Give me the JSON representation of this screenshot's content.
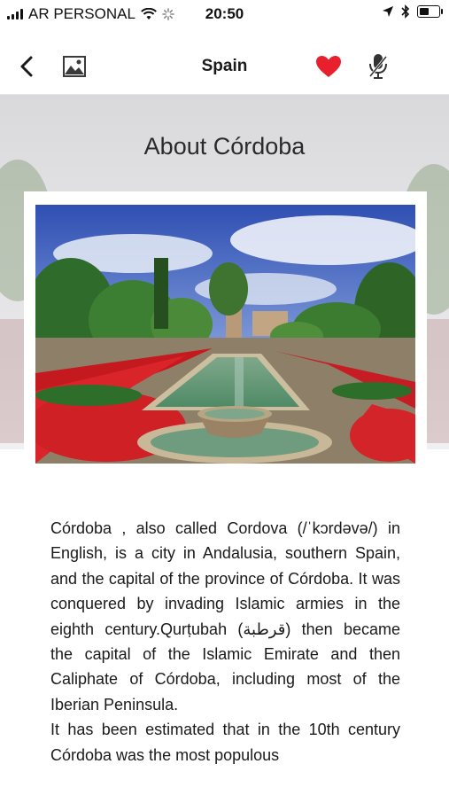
{
  "status_bar": {
    "carrier": "AR PERSONAL",
    "time": "20:50"
  },
  "nav": {
    "title": "Spain",
    "back_icon": "chevron-left-icon",
    "gallery_icon": "image-icon",
    "favorite_icon": "heart-icon",
    "favorite_color": "#e8202d",
    "mic_icon": "microphone-icon"
  },
  "page": {
    "heading": "About Córdoba"
  },
  "article": {
    "p1": "Córdoba , also called Cordova (/ˈkɔrdəvə/) in English, is a city in Andalusia, southern Spain, and the capital of the province of Córdoba. It was conquered by invading Islamic armies in the eighth century.Qurṭubah (قرطبة) then became the capital of the Islamic Emirate and then Caliphate of Córdoba, including most of the Iberian Peninsula.",
    "p2": "It has been estimated that in the 10th century Córdoba was the most populous"
  }
}
